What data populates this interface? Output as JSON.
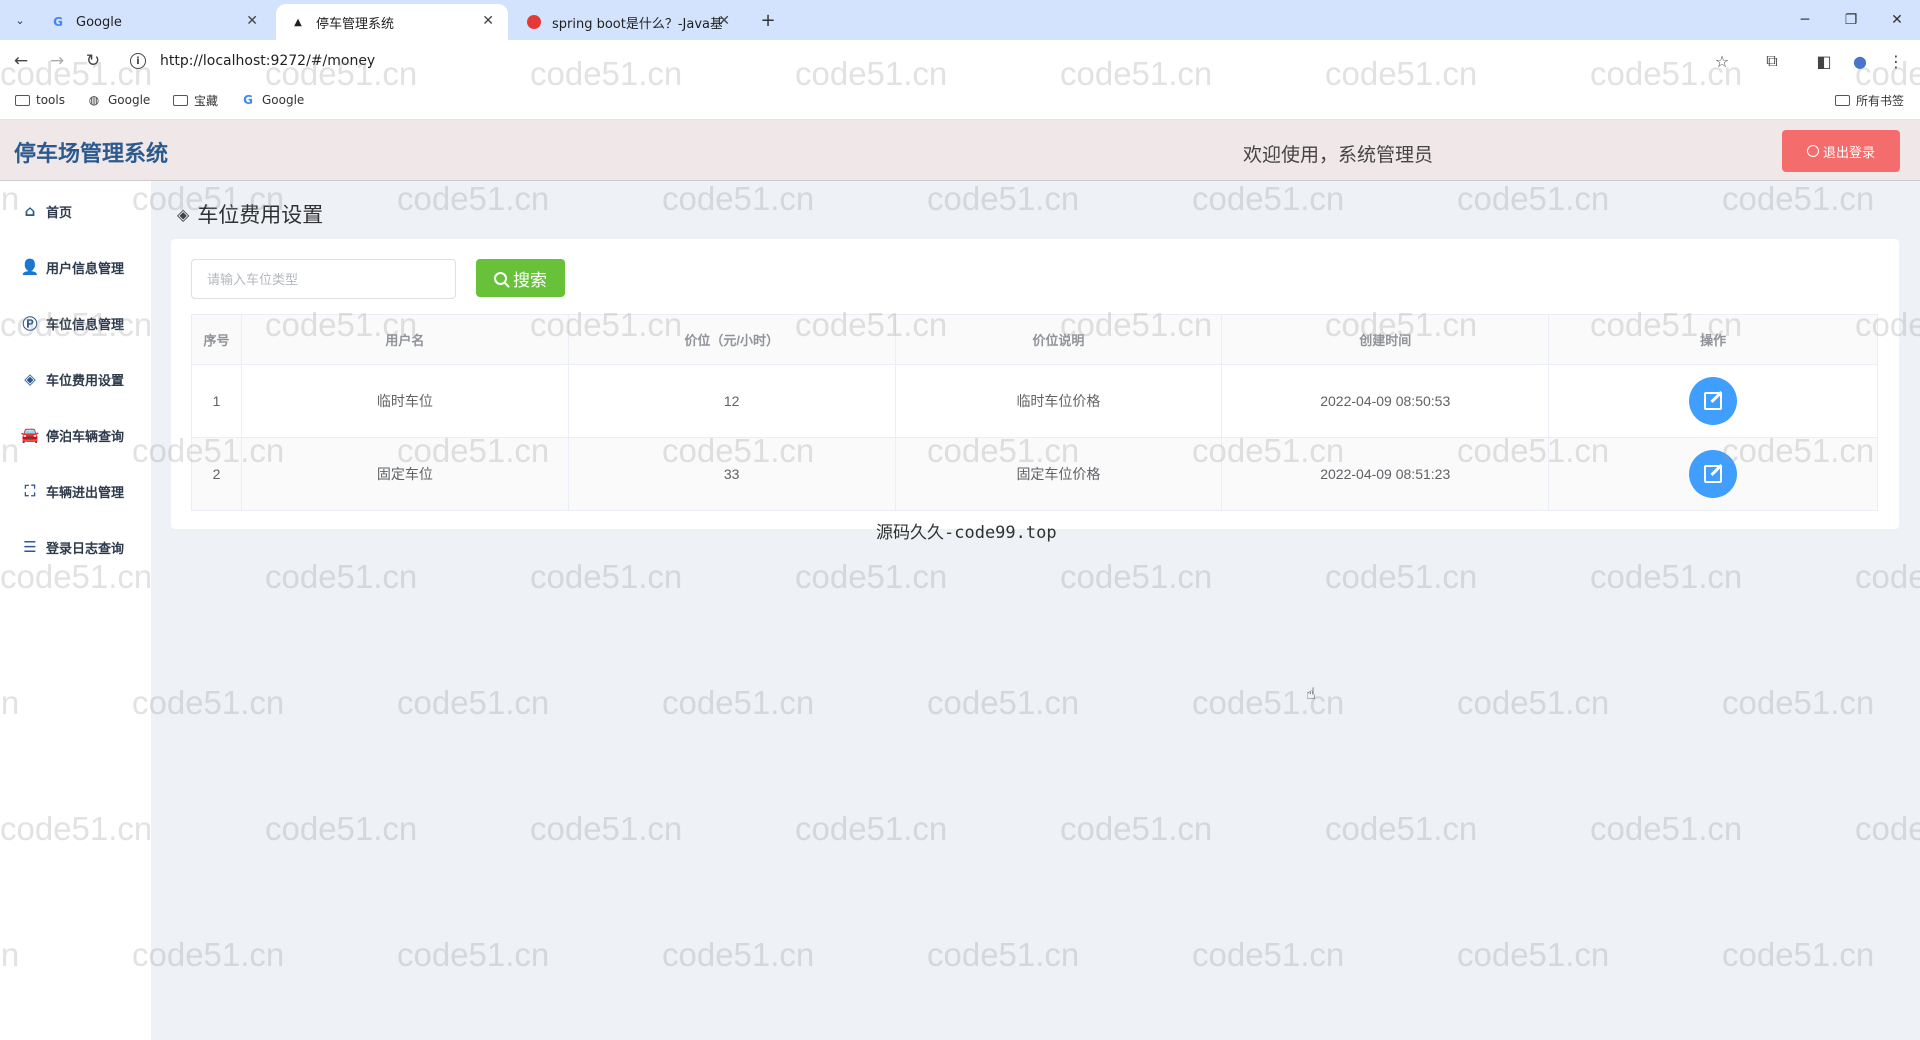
{
  "browser": {
    "tabs": [
      {
        "title": "Google",
        "favicon": "G"
      },
      {
        "title": "停车管理系统",
        "favicon": "car"
      },
      {
        "title": "spring boot是什么？-Java基础",
        "favicon": "red-circle"
      }
    ],
    "url": "http://localhost:9272/#/money",
    "bookmarks": [
      {
        "label": "tools"
      },
      {
        "label": "Google"
      },
      {
        "label": "宝藏"
      },
      {
        "label": "Google"
      }
    ],
    "all_bookmarks": "所有书签"
  },
  "app": {
    "title": "停车场管理系统",
    "welcome": "欢迎使用，系统管理员",
    "logout": "退出登录"
  },
  "sidebar": {
    "items": [
      {
        "label": "首页",
        "icon": "home-icon"
      },
      {
        "label": "用户信息管理",
        "icon": "user-icon"
      },
      {
        "label": "车位信息管理",
        "icon": "parking-icon"
      },
      {
        "label": "车位费用设置",
        "icon": "tag-icon"
      },
      {
        "label": "停泊车辆查询",
        "icon": "car-icon"
      },
      {
        "label": "车辆进出管理",
        "icon": "scan-icon"
      },
      {
        "label": "登录日志查询",
        "icon": "log-icon"
      }
    ]
  },
  "page": {
    "title": "车位费用设置",
    "search_placeholder": "请输入车位类型",
    "search_button": "搜索",
    "columns": [
      "序号",
      "用户名",
      "价位（元/小时）",
      "价位说明",
      "创建时间",
      "操作"
    ],
    "rows": [
      {
        "index": "1",
        "name": "临时车位",
        "price": "12",
        "desc": "临时车位价格",
        "created": "2022-04-09 08:50:53"
      },
      {
        "index": "2",
        "name": "固定车位",
        "price": "33",
        "desc": "固定车位价格",
        "created": "2022-04-09 08:51:23"
      }
    ],
    "footer": "源码久久-code99.top"
  },
  "watermark": "code51.cn",
  "colors": {
    "accent": "#409eff",
    "success": "#67c23a",
    "danger": "#f56c6c",
    "brand": "#2d5a8e"
  }
}
